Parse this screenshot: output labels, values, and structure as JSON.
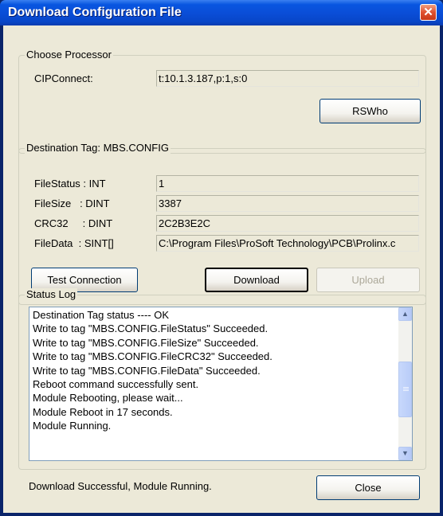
{
  "window": {
    "title": "Download Configuration File",
    "close_glyph": "✕"
  },
  "processor": {
    "legend": "Choose Processor",
    "cip_label": "CIPConnect:",
    "cip_value": "t:10.1.3.187,p:1,s:0",
    "rswho_label": "RSWho"
  },
  "destination": {
    "legend": "Destination Tag: MBS.CONFIG",
    "rows": [
      {
        "label": "FileStatus : INT",
        "value": "1"
      },
      {
        "label": "FileSize   : DINT",
        "value": "3387"
      },
      {
        "label": "CRC32     : DINT",
        "value": "2C2B3E2C"
      },
      {
        "label": "FileData  : SINT[]",
        "value": "C:\\Program Files\\ProSoft Technology\\PCB\\Prolinx.c"
      }
    ],
    "test_connection_label": "Test Connection",
    "download_label": "Download",
    "upload_label": "Upload"
  },
  "status_log": {
    "legend": "Status Log",
    "lines": [
      "Destination Tag status ---- OK",
      "Write to tag \"MBS.CONFIG.FileStatus\" Succeeded.",
      "Write to tag \"MBS.CONFIG.FileSize\" Succeeded.",
      "Write to tag \"MBS.CONFIG.FileCRC32\" Succeeded.",
      "Write to tag \"MBS.CONFIG.FileData\" Succeeded.",
      "Reboot command successfully sent.",
      "Module Rebooting, please wait...",
      "Module Reboot in 17 seconds.",
      "Module Running."
    ],
    "scroll_up_glyph": "▲",
    "scroll_down_glyph": "▼"
  },
  "footer": {
    "status": "Download Successful, Module Running.",
    "close_label": "Close"
  },
  "icons": {
    "close": "close-icon",
    "scroll_up": "chevron-up-icon",
    "scroll_down": "chevron-down-icon"
  }
}
